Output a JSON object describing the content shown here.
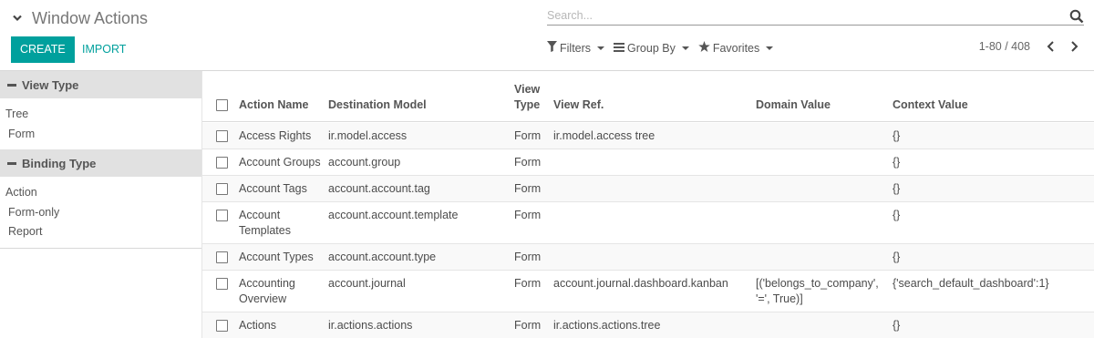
{
  "breadcrumb": {
    "title": "Window Actions"
  },
  "search": {
    "placeholder": "Search..."
  },
  "buttons": {
    "create": "CREATE",
    "import": "IMPORT"
  },
  "searchview": {
    "filters": "Filters",
    "group_by": "Group By",
    "favorites": "Favorites"
  },
  "pager": {
    "value": "1-80 / 408"
  },
  "sidebar": {
    "categories": [
      {
        "title": "View Type",
        "items": [
          "Tree",
          "Form"
        ]
      },
      {
        "title": "Binding Type",
        "items": [
          "Action",
          "Form-only",
          "Report"
        ]
      }
    ]
  },
  "table": {
    "headers": {
      "action_name": "Action Name",
      "destination_model": "Destination Model",
      "view_type_1": "View",
      "view_type_2": "Type",
      "view_ref": "View Ref.",
      "domain_value": "Domain Value",
      "context_value": "Context Value"
    },
    "rows": [
      {
        "name_1": "Access Rights",
        "name_2": "",
        "model": "ir.model.access",
        "view_type": "Form",
        "view_ref": "ir.model.access tree",
        "domain_1": "",
        "domain_2": "",
        "context": "{}"
      },
      {
        "name_1": "Account Groups",
        "name_2": "",
        "model": "account.group",
        "view_type": "Form",
        "view_ref": "",
        "domain_1": "",
        "domain_2": "",
        "context": "{}"
      },
      {
        "name_1": "Account Tags",
        "name_2": "",
        "model": "account.account.tag",
        "view_type": "Form",
        "view_ref": "",
        "domain_1": "",
        "domain_2": "",
        "context": "{}"
      },
      {
        "name_1": "Account",
        "name_2": "Templates",
        "model": "account.account.template",
        "view_type": "Form",
        "view_ref": "",
        "domain_1": "",
        "domain_2": "",
        "context": "{}"
      },
      {
        "name_1": "Account Types",
        "name_2": "",
        "model": "account.account.type",
        "view_type": "Form",
        "view_ref": "",
        "domain_1": "",
        "domain_2": "",
        "context": "{}"
      },
      {
        "name_1": "Accounting",
        "name_2": "Overview",
        "model": "account.journal",
        "view_type": "Form",
        "view_ref": "account.journal.dashboard.kanban",
        "domain_1": "[('belongs_to_company',",
        "domain_2": "'=', True)]",
        "context": "{'search_default_dashboard':1}"
      },
      {
        "name_1": "Actions",
        "name_2": "",
        "model": "ir.actions.actions",
        "view_type": "Form",
        "view_ref": "ir.actions.actions.tree",
        "domain_1": "",
        "domain_2": "",
        "context": "{}"
      }
    ]
  },
  "colors": {
    "primary": "#00a09d",
    "sidebar_header_bg": "#e1e1e1",
    "text": "#4c4c4c"
  }
}
